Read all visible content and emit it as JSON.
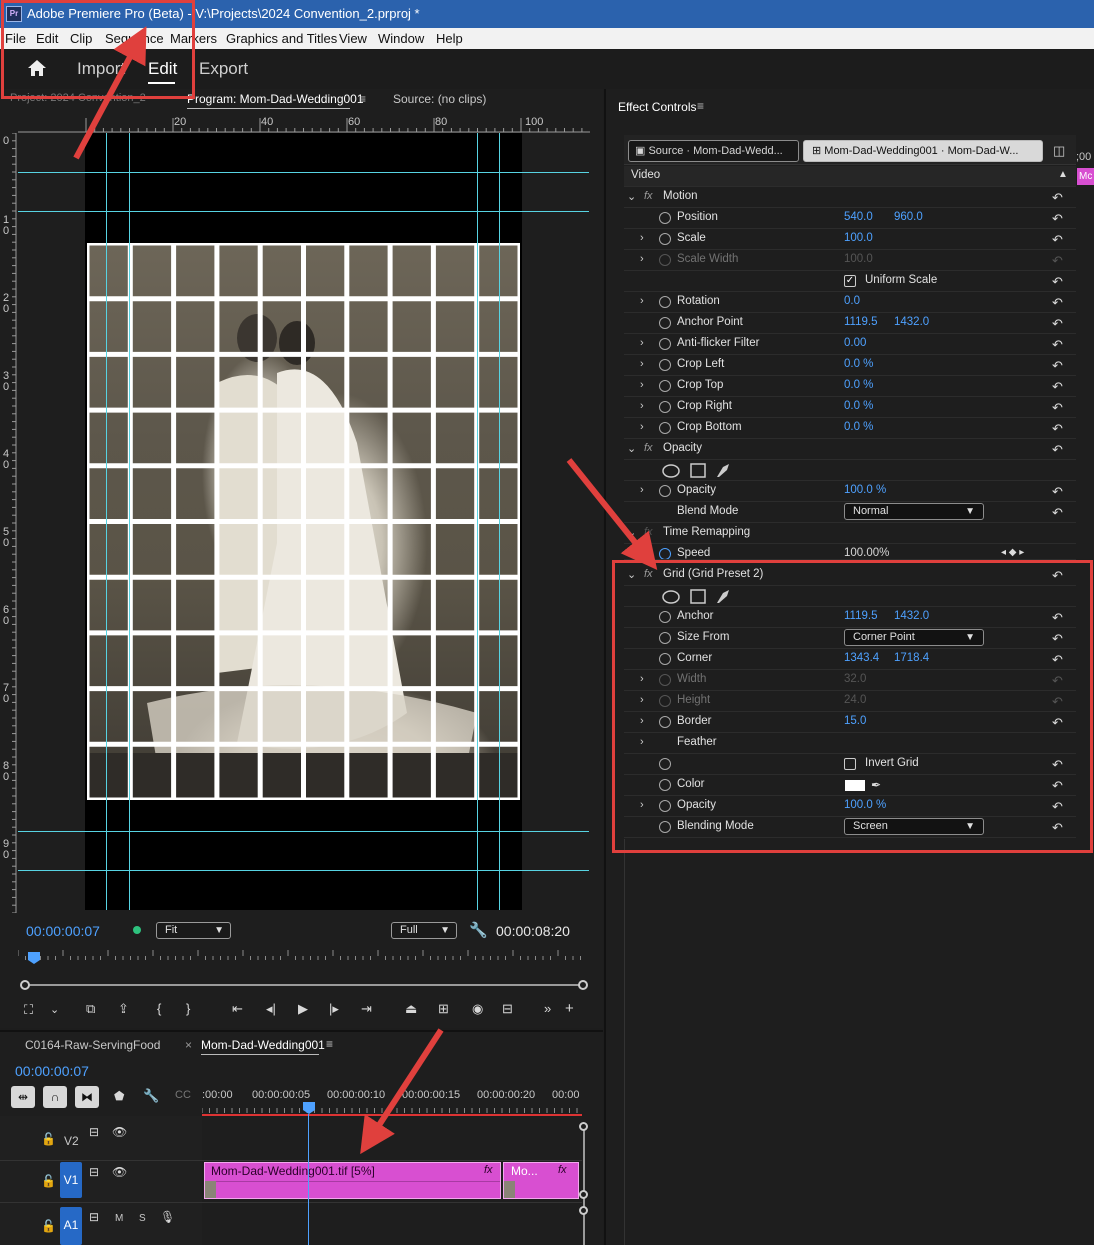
{
  "window": {
    "title": "Adobe Premiere Pro (Beta) - V:\\Projects\\2024 Convention_2.prproj *",
    "logo": "Pr"
  },
  "menu": [
    "File",
    "Edit",
    "Clip",
    "Sequence",
    "Markers",
    "Graphics and Titles",
    "View",
    "Window",
    "Help"
  ],
  "workspaces": {
    "import": "Import",
    "edit": "Edit",
    "export": "Export"
  },
  "program_monitor": {
    "project_tab": "Project: 2024 Convention_2",
    "program_tab": "Program: Mom-Dad-Wedding001",
    "source_tab": "Source: (no clips)",
    "ruler_h": [
      "20",
      "40",
      "60",
      "80",
      "100"
    ],
    "ruler_v": [
      "0",
      "1 0",
      "2 0",
      "3 0",
      "4 0",
      "5 0",
      "6 0",
      "7 0",
      "8 0",
      "9 0"
    ],
    "current_timecode": "00:00:00:07",
    "zoom": "Fit",
    "resolution": "Full",
    "duration": "00:00:08:20"
  },
  "effect_controls": {
    "panel_title": "Effect Controls",
    "source_tab": "Source · Mom-Dad-Wedd...",
    "sequence_tab": "Mom-Dad-Wedding001 · Mom-Dad-W...",
    "timecode_fragment": ";00",
    "clip_fragment": "Mc",
    "section": "Video",
    "motion": {
      "name": "Motion",
      "position_label": "Position",
      "position_x": "540.0",
      "position_y": "960.0",
      "scale_label": "Scale",
      "scale": "100.0",
      "scale_width_label": "Scale Width",
      "scale_width": "100.0",
      "uniform_scale_label": "Uniform Scale",
      "rotation_label": "Rotation",
      "rotation": "0.0",
      "anchor_label": "Anchor Point",
      "anchor_x": "1119.5",
      "anchor_y": "1432.0",
      "antiflicker_label": "Anti-flicker Filter",
      "antiflicker": "0.00",
      "crop_left_label": "Crop Left",
      "crop_left": "0.0 %",
      "crop_top_label": "Crop Top",
      "crop_top": "0.0 %",
      "crop_right_label": "Crop Right",
      "crop_right": "0.0 %",
      "crop_bottom_label": "Crop Bottom",
      "crop_bottom": "0.0 %"
    },
    "opacity": {
      "name": "Opacity",
      "opacity_label": "Opacity",
      "opacity": "100.0 %",
      "blend_label": "Blend Mode",
      "blend": "Normal"
    },
    "time_remapping": {
      "name": "Time Remapping",
      "speed_label": "Speed",
      "speed": "100.00%"
    },
    "grid": {
      "name": "Grid (Grid Preset 2)",
      "anchor_label": "Anchor",
      "anchor_x": "1119.5",
      "anchor_y": "1432.0",
      "size_from_label": "Size From",
      "size_from": "Corner Point",
      "corner_label": "Corner",
      "corner_x": "1343.4",
      "corner_y": "1718.4",
      "width_label": "Width",
      "width": "32.0",
      "height_label": "Height",
      "height": "24.0",
      "border_label": "Border",
      "border": "15.0",
      "feather_label": "Feather",
      "invert_label": "Invert Grid",
      "color_label": "Color",
      "opacity_label": "Opacity",
      "opacity": "100.0 %",
      "blending_label": "Blending Mode",
      "blending": "Screen"
    }
  },
  "timeline": {
    "tab1": "C0164-Raw-ServingFood",
    "tab2": "Mom-Dad-Wedding001",
    "timecode": "00:00:00:07",
    "ruler": [
      ":00:00",
      "00:00:00:05",
      "00:00:00:10",
      "00:00:00:15",
      "00:00:00:20",
      "00:00"
    ],
    "tracks": {
      "v2": "V2",
      "v1": "V1",
      "a1": "A1",
      "m": "M",
      "s": "S"
    },
    "clip1": "Mom-Dad-Wedding001.tif [5%]",
    "clip2": "Mo..."
  },
  "colors": {
    "accent_blue": "#4ea1ff",
    "clip_pink": "#d84fd1",
    "annotation_red": "#e0403d",
    "guide_cyan": "#57d3e2",
    "titlebar": "#2b62ad"
  }
}
